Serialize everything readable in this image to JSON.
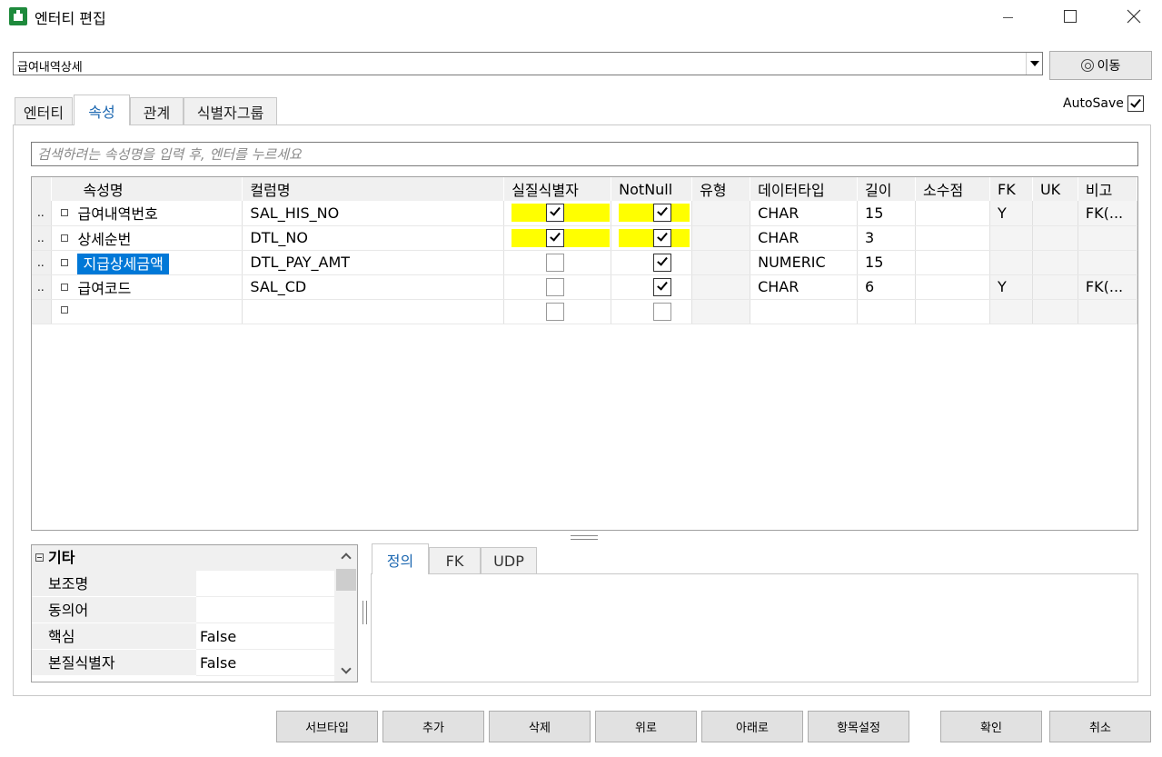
{
  "window": {
    "title": "엔터티 편집"
  },
  "entity_selector": {
    "value": "급여내역상세"
  },
  "move_button": {
    "label": "이동"
  },
  "tabs": [
    {
      "label": "엔터티",
      "active": false
    },
    {
      "label": "속성",
      "active": true
    },
    {
      "label": "관계",
      "active": false
    },
    {
      "label": "식별자그룹",
      "active": false
    }
  ],
  "autosave": {
    "label": "AutoSave",
    "checked": true
  },
  "search": {
    "placeholder": "검색하려는 속성명을 입력 후, 엔터를 누르세요"
  },
  "grid": {
    "columns": [
      "속성명",
      "컬럼명",
      "실질식별자",
      "NotNull",
      "유형",
      "데이터타입",
      "길이",
      "소수점",
      "FK",
      "UK",
      "비고"
    ],
    "rows": [
      {
        "marker": "..",
        "attr": "급여내역번호",
        "column": "SAL_HIS_NO",
        "pk": true,
        "notnull": true,
        "type": "",
        "datatype": "CHAR",
        "length": "15",
        "scale": "",
        "fk": "Y",
        "uk": "",
        "note": "FK(...",
        "selected": false,
        "highlight": true
      },
      {
        "marker": "..",
        "attr": "상세순번",
        "column": "DTL_NO",
        "pk": true,
        "notnull": true,
        "type": "",
        "datatype": "CHAR",
        "length": "3",
        "scale": "",
        "fk": "",
        "uk": "",
        "note": "",
        "selected": false,
        "highlight": true
      },
      {
        "marker": "..",
        "attr": "지급상세금액",
        "column": "DTL_PAY_AMT",
        "pk": false,
        "notnull": true,
        "type": "",
        "datatype": "NUMERIC",
        "length": "15",
        "scale": "",
        "fk": "",
        "uk": "",
        "note": "",
        "selected": true,
        "highlight": false
      },
      {
        "marker": "..",
        "attr": "급여코드",
        "column": "SAL_CD",
        "pk": false,
        "notnull": true,
        "type": "",
        "datatype": "CHAR",
        "length": "6",
        "scale": "",
        "fk": "Y",
        "uk": "",
        "note": "FK(...",
        "selected": false,
        "highlight": false
      },
      {
        "marker": "",
        "attr": "",
        "column": "",
        "pk": false,
        "notnull": false,
        "type": "",
        "datatype": "",
        "length": "",
        "scale": "",
        "fk": "",
        "uk": "",
        "note": "",
        "selected": false,
        "highlight": false
      }
    ]
  },
  "properties": {
    "category": "기타",
    "items": [
      {
        "key": "보조명",
        "value": ""
      },
      {
        "key": "동의어",
        "value": ""
      },
      {
        "key": "핵심",
        "value": "False"
      },
      {
        "key": "본질식별자",
        "value": "False"
      }
    ]
  },
  "detail_tabs": [
    {
      "label": "정의",
      "active": true
    },
    {
      "label": "FK",
      "active": false
    },
    {
      "label": "UDP",
      "active": false
    }
  ],
  "buttons": {
    "subtype": "서브타입",
    "add": "추가",
    "delete": "삭제",
    "up": "위로",
    "down": "아래로",
    "item_settings": "항목설정",
    "ok": "확인",
    "cancel": "취소"
  },
  "colors": {
    "highlight": "#ffff00",
    "selection": "#0078d7",
    "accent_tab": "#1a66b0"
  }
}
